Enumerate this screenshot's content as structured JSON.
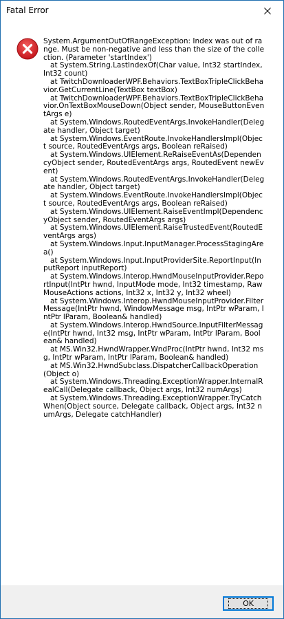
{
  "window": {
    "title": "Fatal Error",
    "close_icon": "close-icon"
  },
  "dialog": {
    "icon": "error-icon",
    "icon_color": "#d7282f",
    "message": "System.ArgumentOutOfRangeException: Index was out of range. Must be non-negative and less than the size of the collection. (Parameter 'startIndex')\n   at System.String.LastIndexOf(Char value, Int32 startIndex, Int32 count)\n   at TwitchDownloaderWPF.Behaviors.TextBoxTripleClickBehavior.GetCurrentLine(TextBox textBox)\n   at TwitchDownloaderWPF.Behaviors.TextBoxTripleClickBehavior.OnTextBoxMouseDown(Object sender, MouseButtonEventArgs e)\n   at System.Windows.RoutedEventArgs.InvokeHandler(Delegate handler, Object target)\n   at System.Windows.EventRoute.InvokeHandlersImpl(Object source, RoutedEventArgs args, Boolean reRaised)\n   at System.Windows.UIElement.ReRaiseEventAs(DependencyObject sender, RoutedEventArgs args, RoutedEvent newEvent)\n   at System.Windows.RoutedEventArgs.InvokeHandler(Delegate handler, Object target)\n   at System.Windows.EventRoute.InvokeHandlersImpl(Object source, RoutedEventArgs args, Boolean reRaised)\n   at System.Windows.UIElement.RaiseEventImpl(DependencyObject sender, RoutedEventArgs args)\n   at System.Windows.UIElement.RaiseTrustedEvent(RoutedEventArgs args)\n   at System.Windows.Input.InputManager.ProcessStagingArea()\n   at System.Windows.Input.InputProviderSite.ReportInput(InputReport inputReport)\n   at System.Windows.Interop.HwndMouseInputProvider.ReportInput(IntPtr hwnd, InputMode mode, Int32 timestamp, RawMouseActions actions, Int32 x, Int32 y, Int32 wheel)\n   at System.Windows.Interop.HwndMouseInputProvider.FilterMessage(IntPtr hwnd, WindowMessage msg, IntPtr wParam, IntPtr lParam, Boolean& handled)\n   at System.Windows.Interop.HwndSource.InputFilterMessage(IntPtr hwnd, Int32 msg, IntPtr wParam, IntPtr lParam, Boolean& handled)\n   at MS.Win32.HwndWrapper.WndProc(IntPtr hwnd, Int32 msg, IntPtr wParam, IntPtr lParam, Boolean& handled)\n   at MS.Win32.HwndSubclass.DispatcherCallbackOperation(Object o)\n   at System.Windows.Threading.ExceptionWrapper.InternalRealCall(Delegate callback, Object args, Int32 numArgs)\n   at System.Windows.Threading.ExceptionWrapper.TryCatchWhen(Object source, Delegate callback, Object args, Int32 numArgs, Delegate catchHandler)"
  },
  "footer": {
    "ok_label": "OK"
  },
  "colors": {
    "accent_border": "#1f6fb0",
    "button_focus": "#0078d7",
    "footer_bg": "#f0f0f0"
  }
}
